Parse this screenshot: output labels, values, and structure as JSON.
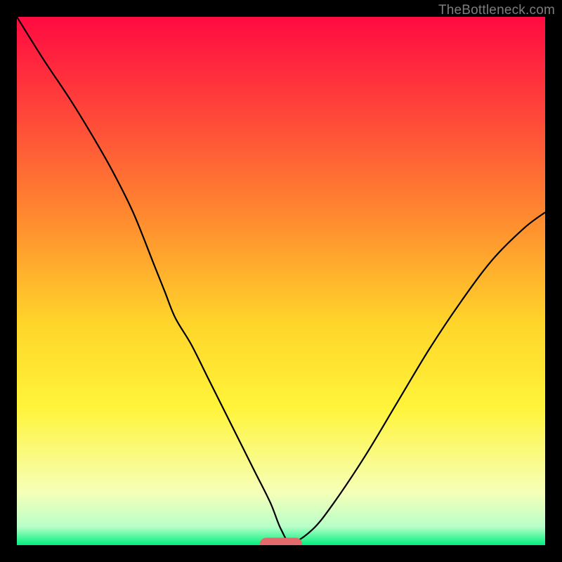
{
  "watermark": "TheBottleneck.com",
  "chart_data": {
    "type": "line",
    "title": "",
    "xlabel": "",
    "ylabel": "",
    "xlim": [
      0,
      100
    ],
    "ylim": [
      0,
      100
    ],
    "background_gradient": {
      "type": "vertical",
      "stops": [
        {
          "pos": 0.0,
          "color": "#ff0a41"
        },
        {
          "pos": 0.18,
          "color": "#ff453a"
        },
        {
          "pos": 0.38,
          "color": "#ff8a2f"
        },
        {
          "pos": 0.58,
          "color": "#ffd52a"
        },
        {
          "pos": 0.74,
          "color": "#fff43a"
        },
        {
          "pos": 0.9,
          "color": "#f6ffb8"
        },
        {
          "pos": 0.965,
          "color": "#b8ffc8"
        },
        {
          "pos": 1.0,
          "color": "#00ef7e"
        }
      ]
    },
    "series": [
      {
        "name": "bottleneck-curve",
        "color": "#000000",
        "width": 2.2,
        "x": [
          0,
          5,
          10,
          14,
          18,
          22,
          26,
          28,
          30,
          33,
          36,
          39,
          42,
          45,
          48,
          50,
          52,
          56,
          60,
          66,
          72,
          78,
          84,
          90,
          96,
          100
        ],
        "y": [
          100,
          92,
          84.5,
          78,
          71,
          63,
          53,
          48,
          43,
          38,
          32,
          26,
          20,
          14,
          8,
          3,
          0.5,
          3,
          8,
          17,
          27,
          37,
          46,
          54,
          60,
          63
        ]
      }
    ],
    "marker": {
      "name": "optimal-point",
      "shape": "capsule",
      "center_x": 50,
      "center_y": 0.2,
      "width": 8,
      "height": 2.4,
      "color": "#e26a6a"
    }
  }
}
